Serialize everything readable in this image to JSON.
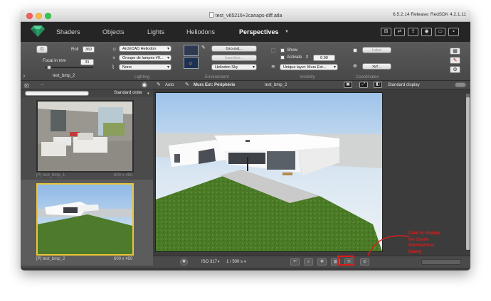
{
  "window": {
    "title": "test_v65216+2canaps-diff.atla",
    "version": "6.5.2.14 Release; RedSDK 4.2.1.11"
  },
  "tabs": [
    {
      "label": "Shaders"
    },
    {
      "label": "Objects"
    },
    {
      "label": "Lights"
    },
    {
      "label": "Heliodons"
    },
    {
      "label": "Perspectives"
    }
  ],
  "active_tab": "Perspectives",
  "camera": {
    "roll_label": "Roll",
    "roll_value": "360",
    "focal_label": "Focal in mm",
    "focal_value": "31",
    "name": "test_bmp_2",
    "help": "?"
  },
  "lighting": {
    "heliodon": "ArchiCAD Heliodon",
    "lamp_group": "Groupe de lampes #0...",
    "third": "None",
    "section": "Lighting"
  },
  "environment": {
    "ground_button": "Ground...",
    "insertion_button": "Insertion...",
    "sky": "Heliodon Sky",
    "section": "Environment"
  },
  "visibility": {
    "show_label": "Show",
    "activate_label": "Activate",
    "value": "0.00",
    "layer": "Unique layer: Murs Ext...",
    "section": "Visibility"
  },
  "coordinates": {
    "label_button": "Label",
    "xyz_button": "xyz...",
    "section": "Coordinates"
  },
  "left_panel": {
    "sort": "Standard order",
    "items": [
      {
        "name": "[P] test_bmp_1",
        "size": "600 x 450"
      },
      {
        "name": "[P] test_bmp_2",
        "size": "600 x 450"
      }
    ]
  },
  "viewer": {
    "auto_label": "Auto",
    "layer_name": "Murs Ext: Périphérie",
    "camera_name": "test_bmp_2",
    "display_mode": "Standard display",
    "iso": "ISO 317",
    "shutter": "1 / 500 s"
  },
  "annotation": {
    "line1": "Click to display",
    "line2": "the Scene",
    "line3": "Informations",
    "line4": "Dialog",
    "color": "#e01b1b"
  }
}
